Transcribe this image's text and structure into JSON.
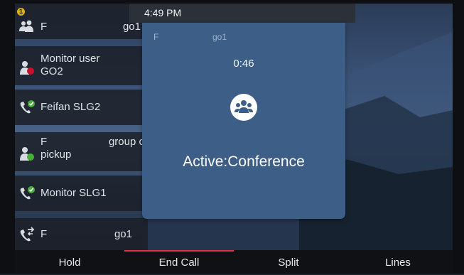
{
  "status_bar": {
    "time": "4:49 PM"
  },
  "line_keys": [
    {
      "label": "F",
      "sub": "go1",
      "icon": "group-icon",
      "badge": "1"
    },
    {
      "label": "Monitor user",
      "label2": "GO2",
      "icon": "monitor-user-busy-icon"
    },
    {
      "label": "Feifan SLG2",
      "icon": "shared-line-icon"
    },
    {
      "label": "F",
      "sub": "group call",
      "label2": "pickup",
      "icon": "pickup-user-idle-icon"
    },
    {
      "label": "Monitor SLG1",
      "icon": "shared-line-icon"
    },
    {
      "label": "F",
      "sub": "go1",
      "icon": "call-transfer-icon"
    }
  ],
  "call": {
    "name": "F",
    "sub": "go1",
    "timer": "0:46",
    "icon": "conference-icon",
    "status": "Active:Conference"
  },
  "softkeys": [
    {
      "label": "Hold"
    },
    {
      "label": "End Call",
      "active": true
    },
    {
      "label": "Split"
    },
    {
      "label": "Lines"
    }
  ],
  "colors": {
    "accent": "#e0304c",
    "card": "#3d5e86",
    "ok_green": "#45b035",
    "busy_red": "#c8102e"
  }
}
